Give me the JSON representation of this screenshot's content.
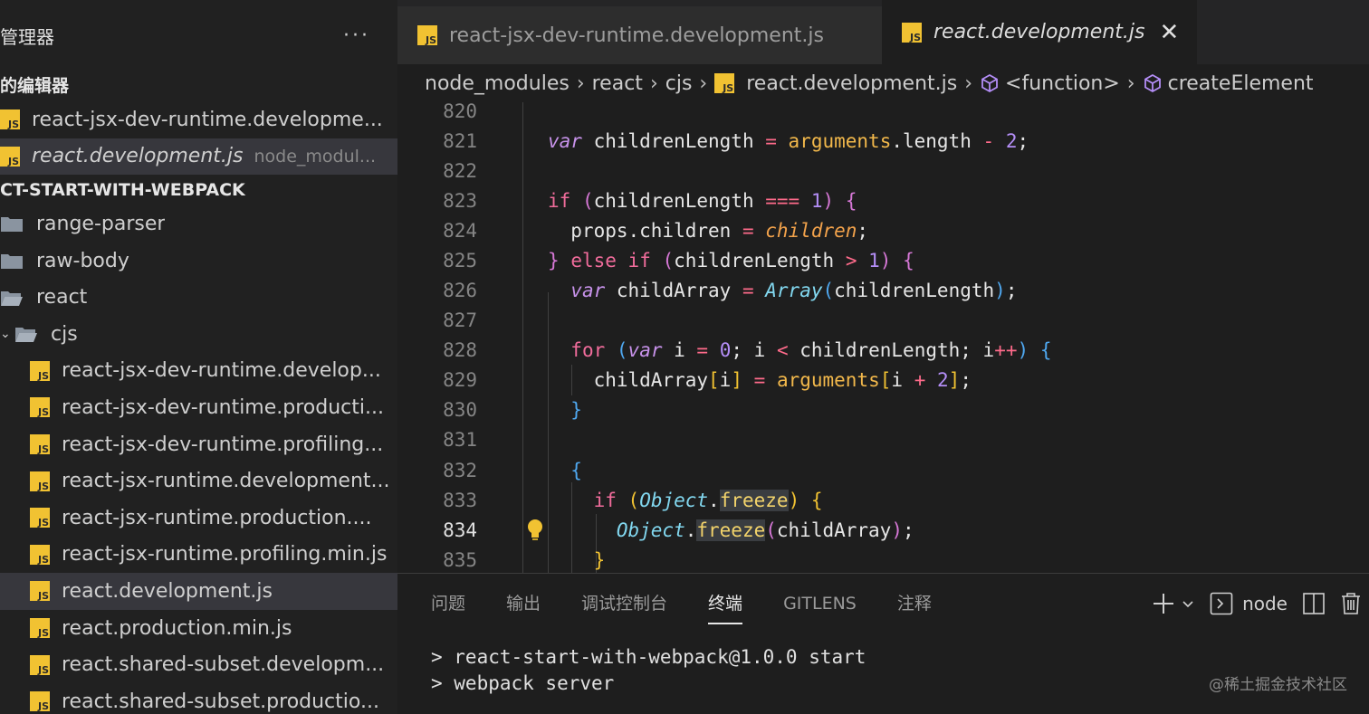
{
  "sidebar": {
    "title": "管理器",
    "more": "···",
    "open_editors_header": "的编辑器",
    "open_editors": [
      {
        "label": "react-jsx-dev-runtime.developme...",
        "desc": ""
      },
      {
        "label": "react.development.js",
        "desc": "node_modul..."
      }
    ],
    "project_header": "CT-START-WITH-WEBPACK",
    "tree": [
      {
        "label": "range-parser"
      },
      {
        "label": "raw-body"
      },
      {
        "label": "react"
      },
      {
        "label": "cjs"
      },
      {
        "label": "react-jsx-dev-runtime.develop..."
      },
      {
        "label": "react-jsx-dev-runtime.producti..."
      },
      {
        "label": "react-jsx-dev-runtime.profiling..."
      },
      {
        "label": "react-jsx-runtime.development..."
      },
      {
        "label": "react-jsx-runtime.production...."
      },
      {
        "label": "react-jsx-runtime.profiling.min.js"
      },
      {
        "label": "react.development.js"
      },
      {
        "label": "react.production.min.js"
      },
      {
        "label": "react.shared-subset.developm..."
      },
      {
        "label": "react.shared-subset.productio..."
      }
    ],
    "js_badge": "JS"
  },
  "tabs": [
    {
      "label": "react-jsx-dev-runtime.development.js"
    },
    {
      "label": "react.development.js",
      "close": "✕"
    }
  ],
  "breadcrumb": {
    "parts": [
      "node_modules",
      "react",
      "cjs",
      "react.development.js",
      "<function>",
      "createElement"
    ],
    "sep": "›"
  },
  "editor": {
    "line_numbers": [
      "820",
      "821",
      "822",
      "823",
      "824",
      "825",
      "826",
      "827",
      "828",
      "829",
      "830",
      "831",
      "832",
      "833",
      "834",
      "835"
    ],
    "current_line": "834"
  },
  "panel": {
    "tabs": [
      "问题",
      "输出",
      "调试控制台",
      "终端",
      "GITLENS",
      "注释"
    ],
    "active_tab": "终端",
    "terminal_name": "node",
    "terminal_lines": [
      "> react-start-with-webpack@1.0.0 start",
      "> webpack server"
    ],
    "watermark": "@稀土掘金技术社区"
  }
}
